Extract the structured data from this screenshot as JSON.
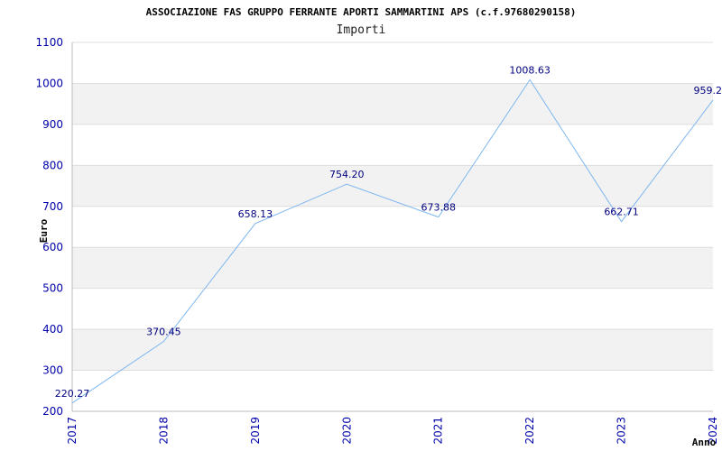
{
  "chart_data": {
    "type": "line",
    "title": "ASSOCIAZIONE FAS GRUPPO FERRANTE APORTI SAMMARTINI APS (c.f.97680290158)",
    "subtitle": "Importi",
    "xlabel": "Anno",
    "ylabel": "Euro",
    "categories": [
      "2017",
      "2018",
      "2019",
      "2020",
      "2021",
      "2022",
      "2023",
      "2024"
    ],
    "series": [
      {
        "values": [
          220.27,
          370.45,
          658.13,
          754.2,
          673.88,
          1008.63,
          662.71,
          959.2
        ],
        "labels": [
          "220.27",
          "370.45",
          "658.13",
          "754.20",
          "673.88",
          "1008.63",
          "662.71",
          "959.2"
        ]
      }
    ],
    "ylim": [
      200,
      1100
    ],
    "yticks": [
      "200",
      "300",
      "400",
      "500",
      "600",
      "700",
      "800",
      "900",
      "1000",
      "1100"
    ],
    "grid": true,
    "colors": {
      "line": "#7eb6f0",
      "band": "#f2f2f2",
      "grid": "#dddddd",
      "ticks": "#0000aa",
      "labels": "#000080"
    }
  }
}
